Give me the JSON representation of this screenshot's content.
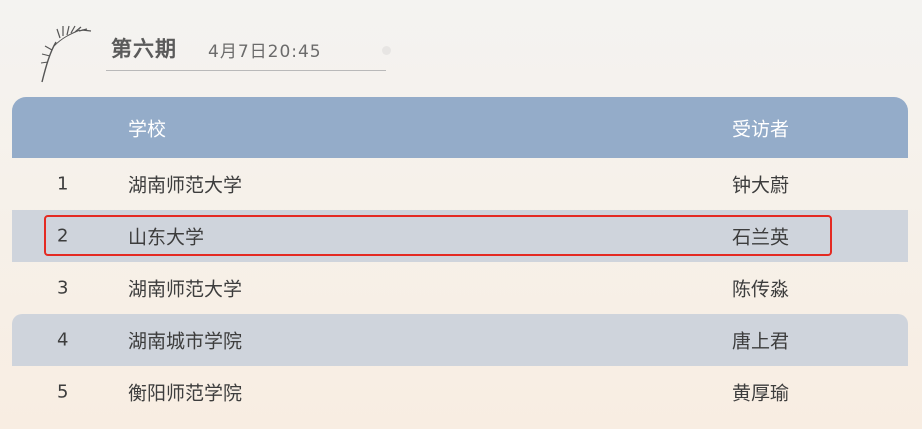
{
  "header": {
    "title": "第六期",
    "date": "4月7日20:45"
  },
  "table": {
    "columns": {
      "school": "学校",
      "interviewee": "受访者"
    },
    "rows": [
      {
        "num": "1",
        "school": "湖南师范大学",
        "interviewee": "钟大蔚"
      },
      {
        "num": "2",
        "school": "山东大学",
        "interviewee": "石兰英"
      },
      {
        "num": "3",
        "school": "湖南师范大学",
        "interviewee": "陈传淼"
      },
      {
        "num": "4",
        "school": "湖南城市学院",
        "interviewee": "唐上君"
      },
      {
        "num": "5",
        "school": "衡阳师范学院",
        "interviewee": "黄厚瑜"
      }
    ],
    "highlighted_row": "2"
  },
  "colors": {
    "header_bg": "#94acc9",
    "shaded_row_bg": "#cfd4dc",
    "highlight_border": "#e42a22"
  },
  "icons": {
    "decoration": "bamboo-icon"
  }
}
